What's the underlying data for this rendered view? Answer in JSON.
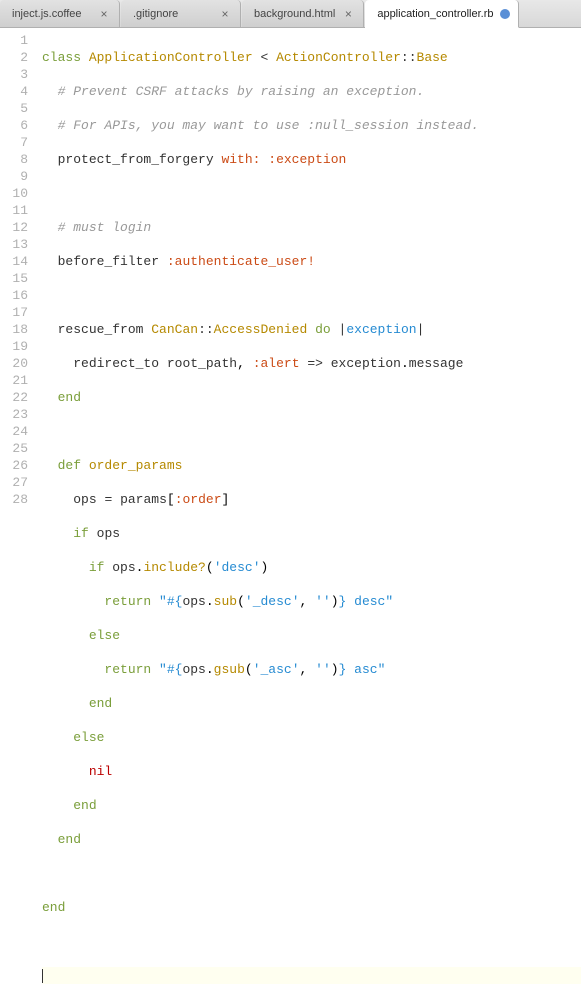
{
  "tabs": [
    {
      "label": "inject.js.coffee",
      "active": false,
      "dirty": false
    },
    {
      "label": ".gitignore",
      "active": false,
      "dirty": false
    },
    {
      "label": "background.html",
      "active": false,
      "dirty": false
    },
    {
      "label": "application_controller.rb",
      "active": true,
      "dirty": true
    }
  ],
  "line_numbers": [
    "1",
    "2",
    "3",
    "4",
    "5",
    "6",
    "7",
    "8",
    "9",
    "10",
    "11",
    "12",
    "13",
    "14",
    "15",
    "16",
    "17",
    "18",
    "19",
    "20",
    "21",
    "22",
    "23",
    "24",
    "25",
    "26",
    "27",
    "28"
  ],
  "code": {
    "l1": {
      "kw1": "class",
      "const1": "ApplicationController",
      "op": "<",
      "const2": "ActionController",
      "sep": "::",
      "const3": "Base"
    },
    "l2": {
      "comment": "# Prevent CSRF attacks by raising an exception."
    },
    "l3": {
      "comment": "# For APIs, you may want to use :null_session instead."
    },
    "l4": {
      "ident": "protect_from_forgery",
      "sym1": "with:",
      "sym2": ":exception"
    },
    "l6": {
      "comment": "# must login"
    },
    "l7": {
      "ident": "before_filter",
      "sym": ":authenticate_user!"
    },
    "l9": {
      "ident": "rescue_from",
      "const": "CanCan",
      "sep": "::",
      "const2": "AccessDenied",
      "kw": "do",
      "bar1": "|",
      "var": "exception",
      "bar2": "|"
    },
    "l10": {
      "ident": "redirect_to",
      "ident2": "root_path",
      "comma": ",",
      "sym": ":alert",
      "arrow": "=>",
      "ident3": "exception",
      "dot": ".",
      "ident4": "message"
    },
    "l11": {
      "kw": "end"
    },
    "l13": {
      "kw": "def",
      "name": "order_params"
    },
    "l14": {
      "ident": "ops",
      "eq": "=",
      "ident2": "params",
      "br1": "[",
      "sym": ":order",
      "br2": "]"
    },
    "l15": {
      "kw": "if",
      "ident": "ops"
    },
    "l16": {
      "kw": "if",
      "ident": "ops",
      "dot": ".",
      "method": "include?",
      "p1": "(",
      "str": "'desc'",
      "p2": ")"
    },
    "l17": {
      "kw": "return",
      "q1": "\"#{",
      "ident": "ops",
      "dot": ".",
      "method": "sub",
      "p1": "(",
      "str1": "'_desc'",
      "comma": ",",
      "str2": "''",
      "p2": ")",
      "q2": "} desc\""
    },
    "l18": {
      "kw": "else"
    },
    "l19": {
      "kw": "return",
      "q1": "\"#{",
      "ident": "ops",
      "dot": ".",
      "method": "gsub",
      "p1": "(",
      "str1": "'_asc'",
      "comma": ",",
      "str2": "''",
      "p2": ")",
      "q2": "} asc\""
    },
    "l20": {
      "kw": "end"
    },
    "l21": {
      "kw": "else"
    },
    "l22": {
      "nil": "nil"
    },
    "l23": {
      "kw": "end"
    },
    "l24": {
      "kw": "end"
    },
    "l26": {
      "kw": "end"
    }
  }
}
